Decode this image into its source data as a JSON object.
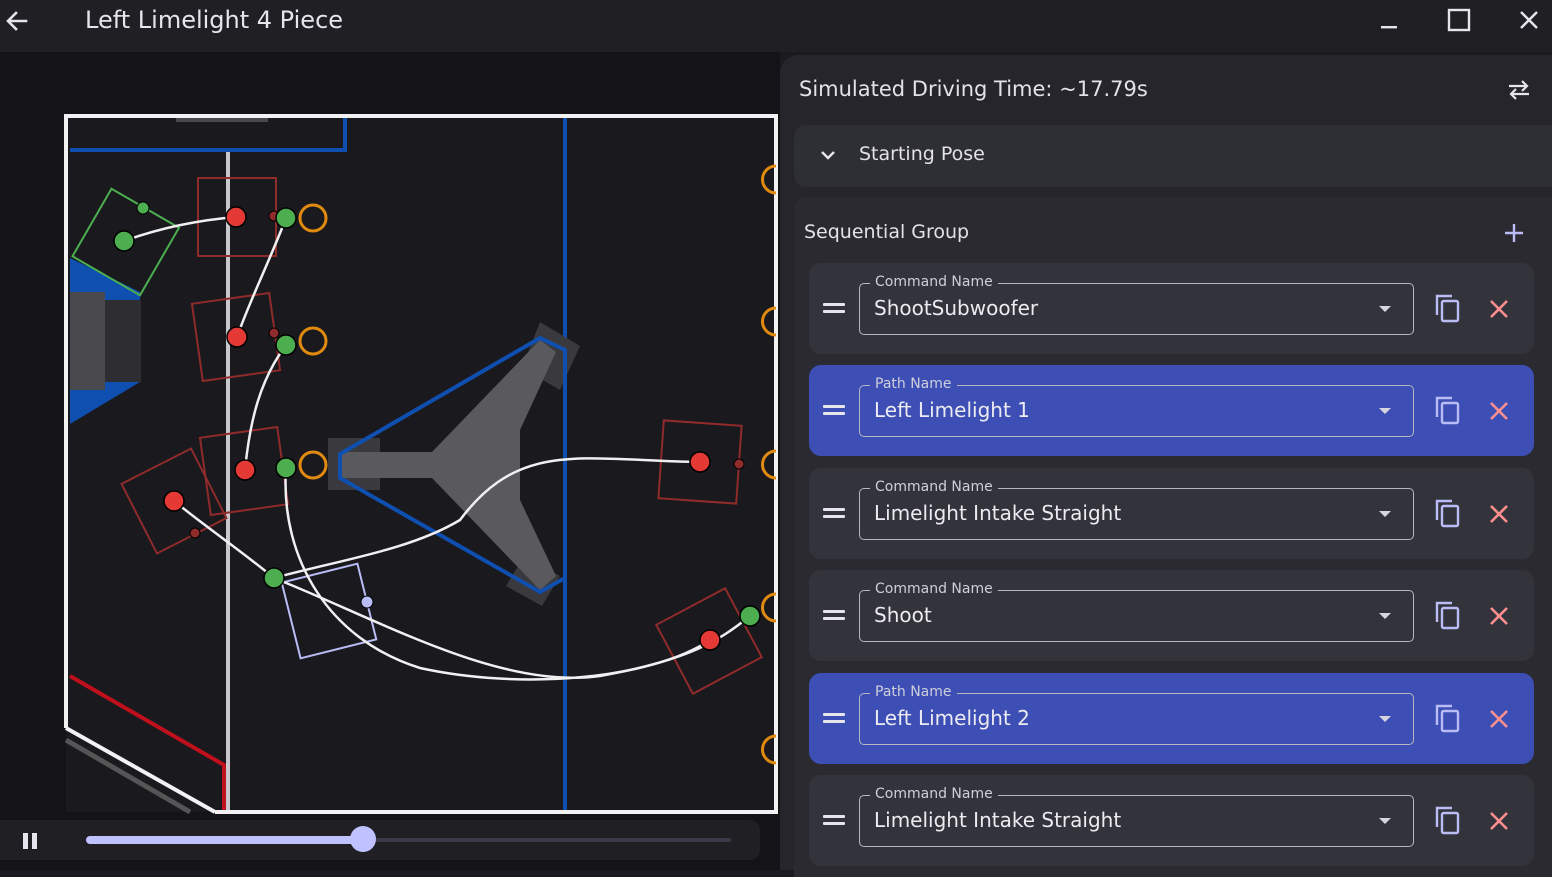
{
  "window": {
    "title": "Left Limelight 4 Piece",
    "icons": {
      "back": "arrow-left-icon",
      "minimize": "minimize-icon",
      "maximize": "maximize-icon",
      "close": "close-icon"
    }
  },
  "field": {
    "alliance_colors": {
      "blue": "#0f4fb0",
      "red": "#c0101c",
      "robot_start": "#4cae4f",
      "robot_end": "#e53935",
      "note_ring": "#e08a10",
      "preview_robot": "#b9bcf5"
    }
  },
  "playback": {
    "pause_icon": "pause-icon",
    "progress": 0.43
  },
  "panel": {
    "simulated_time_label": "Simulated Driving Time: ~17.79s",
    "swap_icon": "swap-horizontal-icon",
    "starting_pose": {
      "label": "Starting Pose",
      "icon": "chevron-down-icon"
    },
    "sequential_group": {
      "label": "Sequential Group",
      "add_icon": "plus-icon",
      "commands": [
        {
          "kind": "command",
          "legend": "Command Name",
          "value": "ShootSubwoofer"
        },
        {
          "kind": "path",
          "legend": "Path Name",
          "value": "Left Limelight 1"
        },
        {
          "kind": "command",
          "legend": "Command Name",
          "value": "Limelight Intake Straight"
        },
        {
          "kind": "command",
          "legend": "Command Name",
          "value": "Shoot"
        },
        {
          "kind": "path",
          "legend": "Path Name",
          "value": "Left Limelight 2"
        },
        {
          "kind": "command",
          "legend": "Command Name",
          "value": "Limelight Intake Straight"
        }
      ]
    }
  }
}
